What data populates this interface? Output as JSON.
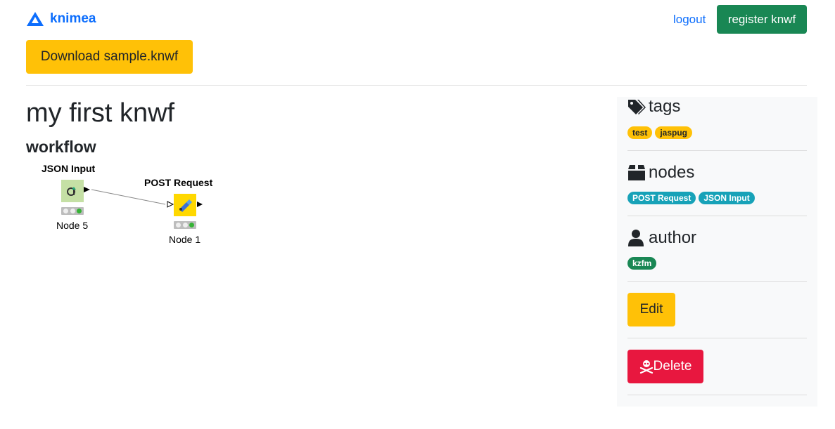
{
  "nav": {
    "brand": "knimea",
    "logout": "logout",
    "register": "register knwf"
  },
  "download_label": "Download sample.knwf",
  "page": {
    "title": "my first knwf",
    "section": "workflow"
  },
  "workflow": {
    "nodes": [
      {
        "label": "JSON Input",
        "name": "Node 5",
        "color": "#c5e0a5",
        "icon": "json-input-icon"
      },
      {
        "label": "POST Request",
        "name": "Node 1",
        "color": "#ffd800",
        "icon": "post-request-icon"
      }
    ]
  },
  "sidebar": {
    "tags": {
      "title": "tags",
      "items": [
        "test",
        "jaspug"
      ]
    },
    "nodes": {
      "title": "nodes",
      "items": [
        "POST Request",
        "JSON Input"
      ]
    },
    "author": {
      "title": "author",
      "items": [
        "kzfm"
      ]
    },
    "edit": "Edit",
    "delete": "Delete"
  },
  "colors": {
    "primary": "#0d6efd",
    "success": "#198754",
    "warning": "#ffc107",
    "info": "#17a2b8",
    "danger": "#e8173f"
  }
}
